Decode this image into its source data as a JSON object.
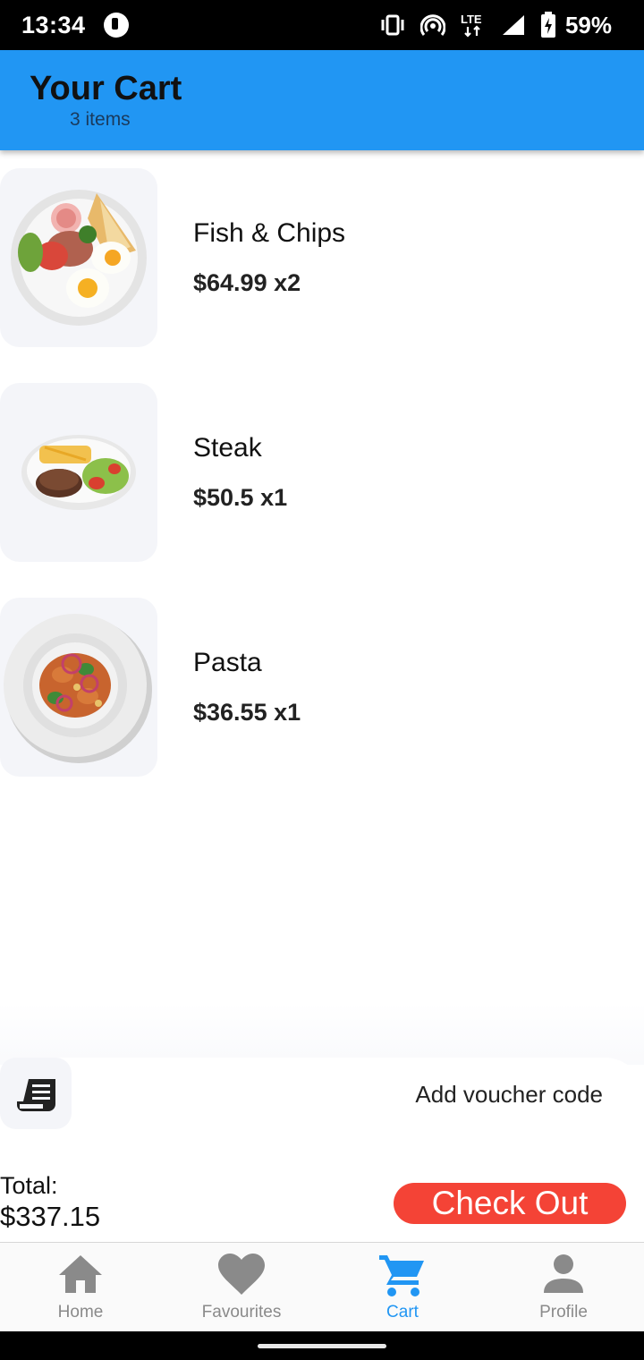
{
  "status_bar": {
    "time": "13:34",
    "battery": "59%",
    "network": "LTE",
    "icons": [
      "vibrate-icon",
      "hotspot-icon",
      "lte-icon",
      "signal-icon",
      "battery-icon"
    ]
  },
  "header": {
    "title": "Your Cart",
    "subtitle": "3 items",
    "color": "#2196F3"
  },
  "cart": {
    "items": [
      {
        "name": "Fish & Chips",
        "price": "$64.99",
        "qty": " x2"
      },
      {
        "name": "Steak",
        "price": "$50.5",
        "qty": " x1"
      },
      {
        "name": "Pasta",
        "price": "$36.55",
        "qty": " x1"
      }
    ]
  },
  "voucher": {
    "label": "Add voucher code",
    "icon": "receipt-icon"
  },
  "summary": {
    "total_label": "Total:",
    "total_value": "$337.15",
    "checkout_label": "Check Out",
    "checkout_color": "#F44336"
  },
  "nav": {
    "items": [
      {
        "label": "Home",
        "icon": "home-icon",
        "active": false
      },
      {
        "label": "Favourites",
        "icon": "heart-icon",
        "active": false
      },
      {
        "label": "Cart",
        "icon": "cart-icon",
        "active": true
      },
      {
        "label": "Profile",
        "icon": "person-icon",
        "active": false
      }
    ],
    "active_color": "#2196F3",
    "inactive_color": "#8a8a8a"
  }
}
